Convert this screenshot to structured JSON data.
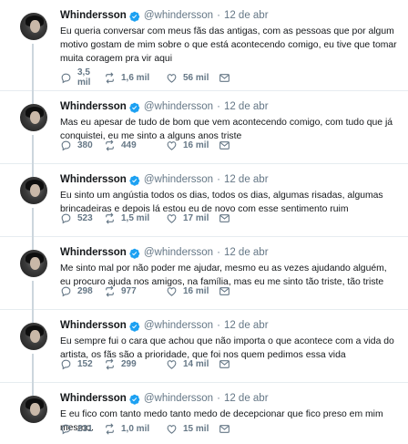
{
  "author": {
    "name": "Whindersson",
    "handle": "@whindersson"
  },
  "tweets": [
    {
      "time": "12 de abr",
      "text": "Eu queria conversar com meus fãs das antigas, com as pessoas que por algum motivo gostam de mim sobre o que está acontecendo comigo, eu tive que tomar muita coragem pra vir aqui",
      "replies": "3,5 mil",
      "retweets": "1,6 mil",
      "likes": "56 mil"
    },
    {
      "time": "12 de abr",
      "text": "Mas eu apesar de tudo de bom que vem acontecendo comigo, com tudo que já conquistei, eu me sinto a alguns anos triste",
      "replies": "380",
      "retweets": "449",
      "likes": "16 mil"
    },
    {
      "time": "12 de abr",
      "text": "Eu sinto um angústia todos os dias, todos os dias, algumas risadas, algumas brincadeiras e depois lá estou eu de novo com esse sentimento ruim",
      "replies": "523",
      "retweets": "1,5 mil",
      "likes": "17 mil"
    },
    {
      "time": "12 de abr",
      "text": "Me sinto mal por não poder me ajudar, mesmo eu as vezes ajudando alguém, eu procuro ajuda nos amigos, na família, mas eu me sinto tão triste, tão triste",
      "replies": "298",
      "retweets": "977",
      "likes": "16 mil"
    },
    {
      "time": "12 de abr",
      "text": "Eu sempre fui o cara que achou que não importa o que acontece com a vida do artista, os fãs são a prioridade, que foi nos quem pedimos essa vida",
      "replies": "152",
      "retweets": "299",
      "likes": "14 mil"
    },
    {
      "time": "12 de abr",
      "text": "E eu fico com tanto medo tanto medo de decepcionar que fico preso em mim mesmo.",
      "replies": "231",
      "retweets": "1,0 mil",
      "likes": "15 mil"
    }
  ],
  "colors": {
    "text": "#14171a",
    "muted": "#657786",
    "verified": "#1da1f2",
    "rail": "#ccd6dd",
    "divider": "#e6ecf0"
  },
  "icons": [
    "verified-icon",
    "reply-icon",
    "retweet-icon",
    "like-icon",
    "dm-icon"
  ]
}
